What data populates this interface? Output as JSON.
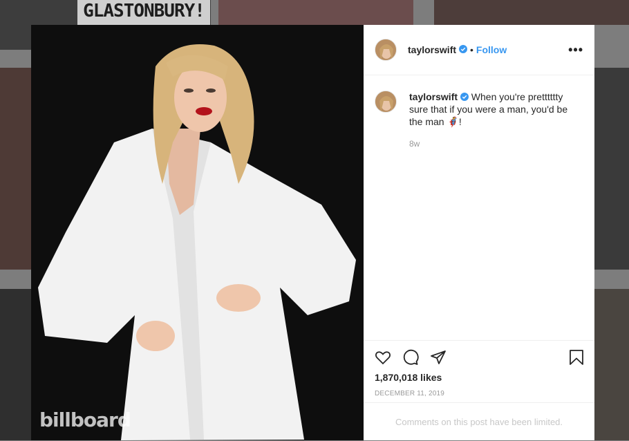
{
  "background": {
    "banner_text": "GLASTONBURY!"
  },
  "post": {
    "username": "taylorswift",
    "follow_label": "Follow",
    "separator": "•",
    "more_label": "•••",
    "caption": "When you're pretttttty sure that if you were a man, you'd be the man 🦸!",
    "age": "8w",
    "likes": "1,870,018 likes",
    "date": "DECEMBER 11, 2019",
    "comments_notice": "Comments on this post have been limited.",
    "photo_watermark": "billboard"
  },
  "colors": {
    "accent": "#3897f0",
    "text": "#262626",
    "muted": "#999999"
  },
  "icons": [
    "verified-badge-icon",
    "heart-icon",
    "comment-icon",
    "share-icon",
    "bookmark-icon",
    "more-options-icon"
  ]
}
